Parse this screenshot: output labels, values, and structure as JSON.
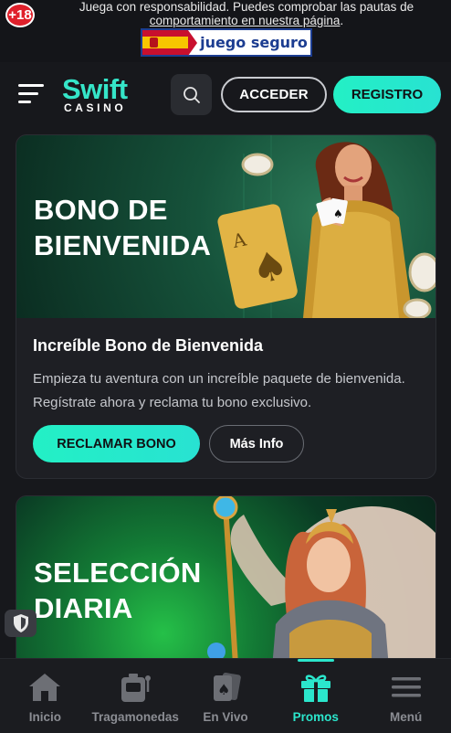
{
  "banner": {
    "age_label": "+18",
    "notice_line1": "Juega con responsabilidad. Puedes comprobar las pautas de",
    "notice_link": "comportamiento en nuestra página",
    "notice_end": ".",
    "seal_text": "juego seguro"
  },
  "header": {
    "logo_main": "Swift",
    "logo_sub": "CASINO",
    "login_label": "ACCEDER",
    "register_label": "REGISTRO"
  },
  "promos": [
    {
      "hero_title_line1": "BONO DE",
      "hero_title_line2": "BIENVENIDA",
      "subtitle": "Increíble Bono de Bienvenida",
      "description": "Empieza tu aventura con un increíble paquete de bienvenida. Regístrate ahora y reclama tu bono exclusivo.",
      "claim_label": "RECLAMAR BONO",
      "more_label": "Más Info"
    },
    {
      "hero_title_line1": "SELECCIÓN",
      "hero_title_line2": "DIARIA"
    }
  ],
  "bottom_nav": [
    {
      "label": "Inicio",
      "icon": "home-icon"
    },
    {
      "label": "Tragamonedas",
      "icon": "slot-machine-icon"
    },
    {
      "label": "En Vivo",
      "icon": "cards-icon"
    },
    {
      "label": "Promos",
      "icon": "gift-icon",
      "active": true
    },
    {
      "label": "Menú",
      "icon": "menu-icon"
    }
  ],
  "colors": {
    "accent": "#2be6cc",
    "background": "#17181c",
    "card": "#1e1f24",
    "age_badge": "#e0202b"
  }
}
